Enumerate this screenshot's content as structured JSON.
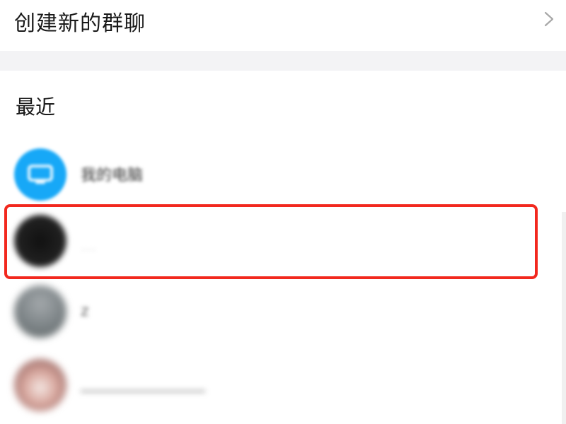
{
  "create_group": {
    "label": "创建新的群聊",
    "chevron_icon": "chevron-right-icon"
  },
  "recent": {
    "heading": "最近",
    "contacts": [
      {
        "name": "我的电脑",
        "avatar_icon": "monitor-icon",
        "avatar_color": "#17a8f7"
      },
      {
        "name": "…",
        "avatar_color": "#1f1f1f",
        "highlighted": true
      },
      {
        "name": "z",
        "avatar_color": "#7f8689"
      },
      {
        "name": "________________",
        "avatar_color": "#d9a9a0"
      }
    ]
  },
  "colors": {
    "highlight": "#f2281e",
    "divider": "#f3f3f5",
    "accent": "#17a8f7"
  }
}
